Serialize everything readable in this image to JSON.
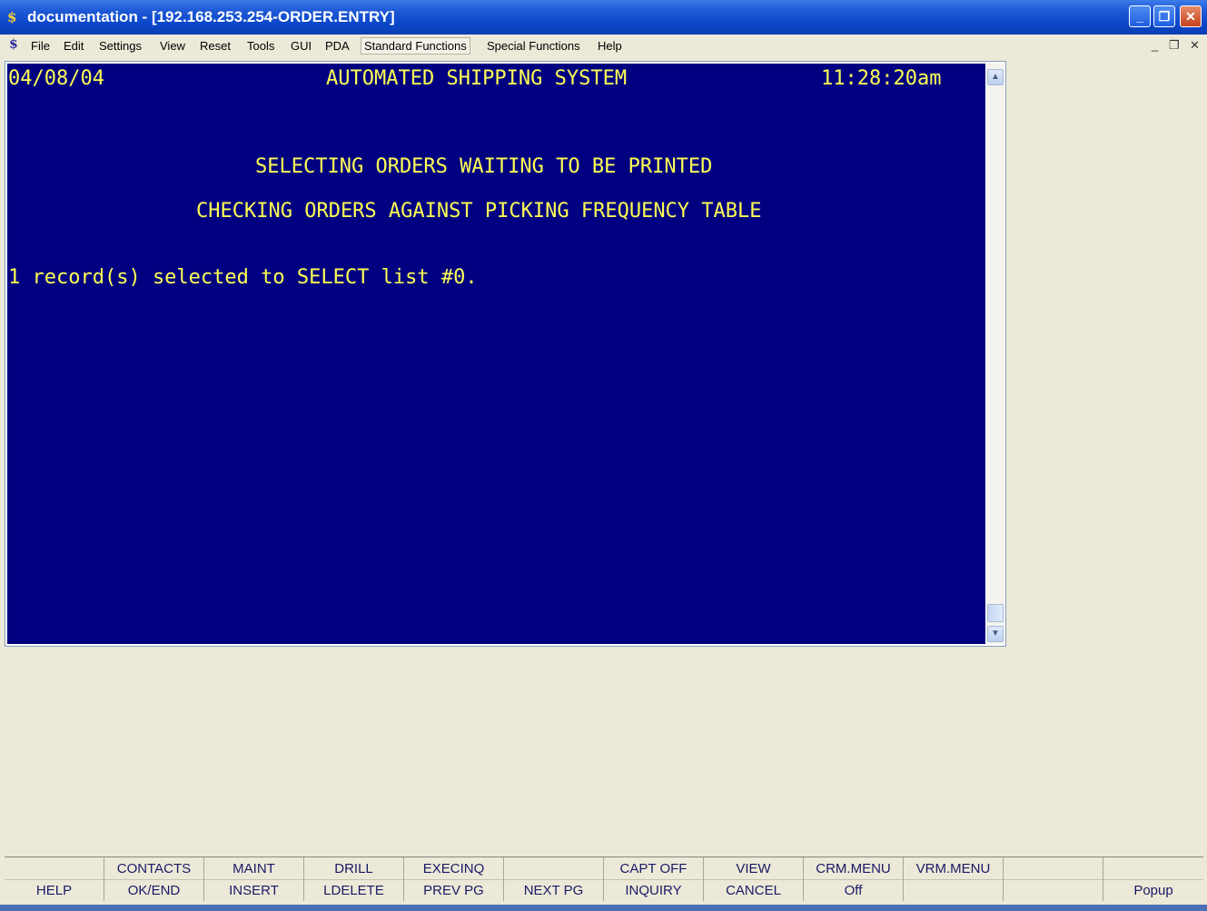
{
  "window": {
    "app_icon": "$",
    "title": "documentation - [192.168.253.254-ORDER.ENTRY]",
    "buttons": {
      "minimize": "_",
      "restore": "❐",
      "close": "✕"
    }
  },
  "menubar": {
    "icon": "$",
    "items": [
      "File",
      "Edit",
      "Settings",
      "View",
      "Reset",
      "Tools",
      "GUI",
      "PDA",
      "Standard Functions",
      "Special Functions",
      "Help"
    ],
    "mdi_minimize": "_",
    "mdi_restore": "❐",
    "mdi_close": "✕"
  },
  "terminal": {
    "date": "04/08/04",
    "header": "AUTOMATED SHIPPING SYSTEM",
    "time": "11:28:20am",
    "line1": "SELECTING ORDERS WAITING TO BE PRINTED",
    "line2": "CHECKING ORDERS AGAINST PICKING FREQUENCY TABLE",
    "message": "1 record(s) selected to SELECT list #0.",
    "fg_color": "#ffff55",
    "bg_color": "#000080"
  },
  "scrollbar": {
    "up_icon": "▲",
    "down_icon": "▼"
  },
  "function_keys": [
    {
      "top": "",
      "bottom": "HELP"
    },
    {
      "top": "CONTACTS",
      "bottom": "OK/END"
    },
    {
      "top": "MAINT",
      "bottom": "INSERT"
    },
    {
      "top": "DRILL",
      "bottom": "LDELETE"
    },
    {
      "top": "EXECINQ",
      "bottom": "PREV PG"
    },
    {
      "top": "",
      "bottom": "NEXT PG"
    },
    {
      "top": "CAPT OFF",
      "bottom": "INQUIRY"
    },
    {
      "top": "VIEW",
      "bottom": "CANCEL"
    },
    {
      "top": "CRM.MENU",
      "bottom": "Off"
    },
    {
      "top": "VRM.MENU",
      "bottom": ""
    },
    {
      "top": "",
      "bottom": ""
    },
    {
      "top": "",
      "bottom": "Popup"
    }
  ]
}
